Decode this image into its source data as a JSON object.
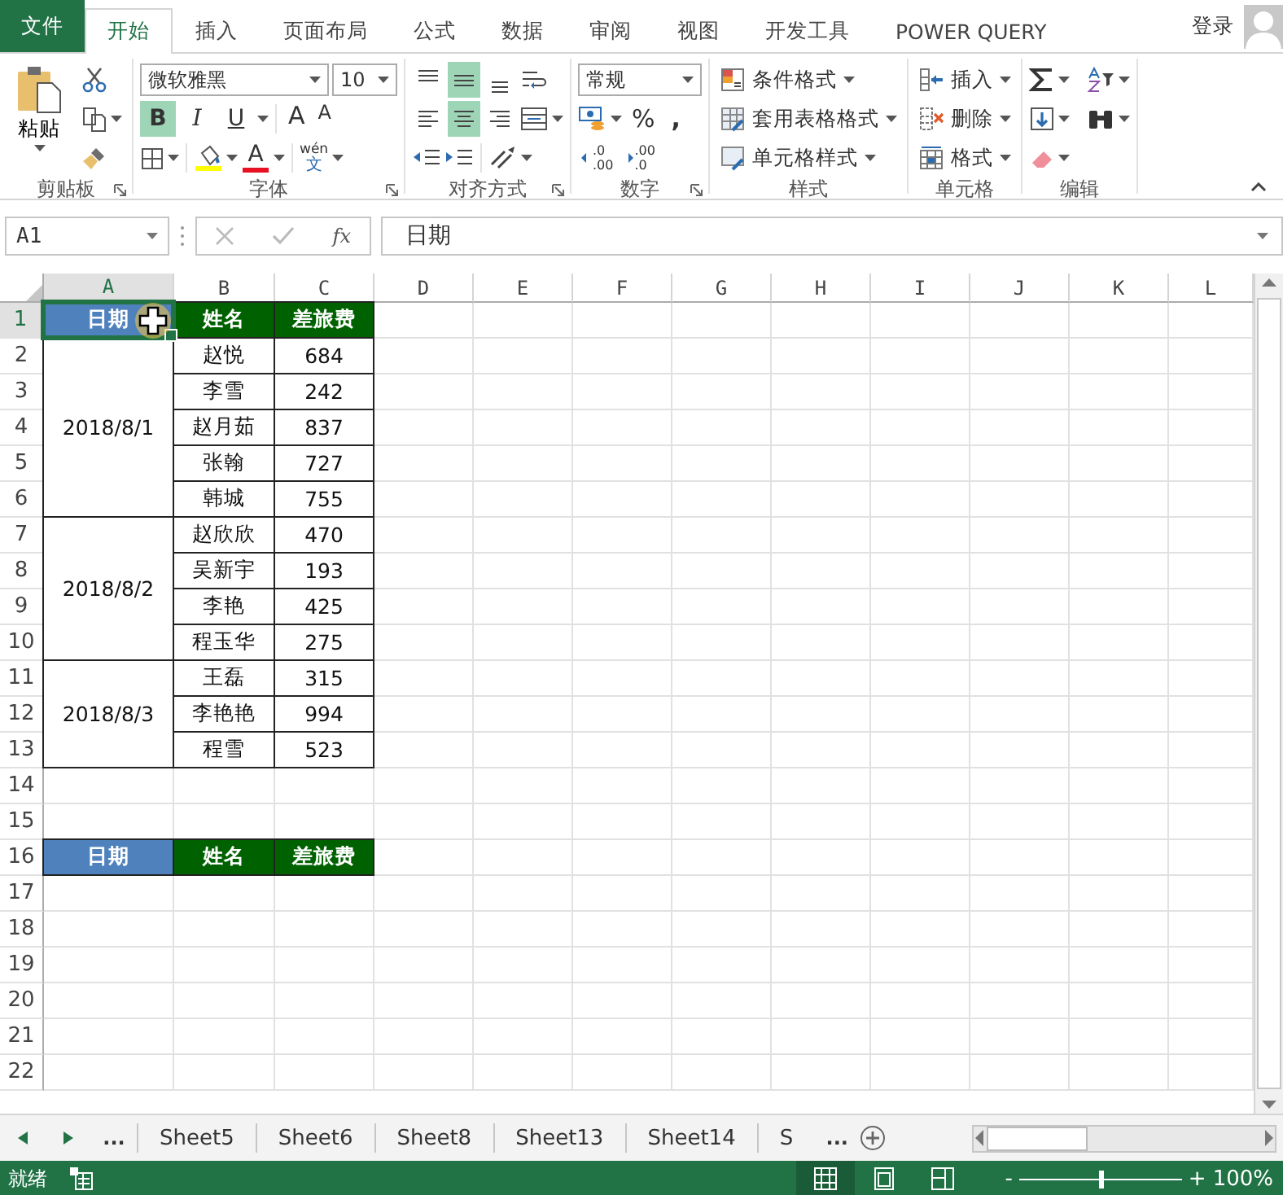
{
  "ribbon_tabs": [
    {
      "label": "文件",
      "kind": "file",
      "selected": false
    },
    {
      "label": "开始",
      "kind": "tab",
      "selected": true
    },
    {
      "label": "插入",
      "kind": "tab",
      "selected": false
    },
    {
      "label": "页面布局",
      "kind": "tab",
      "selected": false
    },
    {
      "label": "公式",
      "kind": "tab",
      "selected": false
    },
    {
      "label": "数据",
      "kind": "tab",
      "selected": false
    },
    {
      "label": "审阅",
      "kind": "tab",
      "selected": false
    },
    {
      "label": "视图",
      "kind": "tab",
      "selected": false
    },
    {
      "label": "开发工具",
      "kind": "tab",
      "selected": false
    },
    {
      "label": "POWER QUERY",
      "kind": "tab",
      "selected": false
    }
  ],
  "account": {
    "label": "登录"
  },
  "ribbon": {
    "groups": [
      {
        "kind": "clipboard",
        "label": "剪贴板",
        "launcher": true,
        "paste": "粘贴"
      },
      {
        "kind": "font",
        "label": "字体",
        "launcher": true,
        "font_name": "微软雅黑",
        "font_size": "10",
        "style_buttons": [
          {
            "kind": "bold",
            "text": "B",
            "selected": true
          },
          {
            "kind": "italic",
            "text": "I",
            "selected": false
          },
          {
            "kind": "underline",
            "text": "U",
            "selected": false
          }
        ],
        "size_buttons": [
          {
            "kind": "grow",
            "text": "A"
          },
          {
            "kind": "shrink",
            "text": "A"
          }
        ],
        "color_buttons": [
          {
            "kind": "fill",
            "color": "#ffff00"
          },
          {
            "kind": "font",
            "text": "A",
            "color": "#e81123"
          }
        ],
        "phonetic": {
          "top": "wén",
          "bottom": "文"
        }
      },
      {
        "kind": "alignment",
        "label": "对齐方式",
        "launcher": true,
        "buttons": [
          {
            "kind": "top",
            "selected": false
          },
          {
            "kind": "middle",
            "selected": true
          },
          {
            "kind": "bottom",
            "selected": false
          },
          {
            "kind": "left",
            "selected": false
          },
          {
            "kind": "center",
            "selected": true
          },
          {
            "kind": "right",
            "selected": false
          }
        ]
      },
      {
        "kind": "number",
        "label": "数字",
        "launcher": true,
        "format": "常规",
        "percent": "%",
        "comma": ",",
        "decimals": [
          {
            "kind": "increase",
            "top": ".0",
            "bottom": ".00"
          },
          {
            "kind": "decrease",
            "top": ".00",
            "bottom": ".0"
          }
        ]
      },
      {
        "kind": "styles",
        "label": "样式",
        "launcher": false,
        "items": [
          {
            "kind": "conditional",
            "text": "条件格式"
          },
          {
            "kind": "table",
            "text": "套用表格格式"
          },
          {
            "kind": "cell",
            "text": "单元格样式"
          }
        ]
      },
      {
        "kind": "cells",
        "label": "单元格",
        "launcher": false,
        "items": [
          {
            "kind": "insert",
            "text": "插入"
          },
          {
            "kind": "delete",
            "text": "删除"
          },
          {
            "kind": "format",
            "text": "格式"
          }
        ]
      },
      {
        "kind": "editing",
        "label": "编辑",
        "launcher": false
      }
    ]
  },
  "formula_bar": {
    "name_box": "A1",
    "fx": "fx",
    "value": "日期"
  },
  "sheet": {
    "columns": [
      {
        "label": "A",
        "selected": true
      },
      {
        "label": "B",
        "selected": false
      },
      {
        "label": "C",
        "selected": false
      },
      {
        "label": "D",
        "selected": false
      },
      {
        "label": "E",
        "selected": false
      },
      {
        "label": "F",
        "selected": false
      },
      {
        "label": "G",
        "selected": false
      },
      {
        "label": "H",
        "selected": false
      },
      {
        "label": "I",
        "selected": false
      },
      {
        "label": "J",
        "selected": false
      },
      {
        "label": "K",
        "selected": false
      },
      {
        "label": "L",
        "selected": false
      }
    ],
    "rows": [
      {
        "label": "1",
        "selected": true,
        "cells": [
          {
            "kind": "header",
            "text": "日期",
            "color": "#4f81bd",
            "selected": true
          },
          {
            "kind": "header",
            "text": "姓名",
            "color": "#006100",
            "selected": false
          },
          {
            "kind": "header",
            "text": "差旅费",
            "color": "#006100",
            "selected": false
          }
        ]
      },
      {
        "label": "2",
        "selected": false,
        "cells": [
          {
            "kind": "date",
            "text": "2018/8/1",
            "selected": false
          },
          {
            "kind": "text",
            "text": "赵悦",
            "selected": false
          },
          {
            "kind": "text",
            "text": "684",
            "selected": false
          }
        ]
      },
      {
        "label": "3",
        "selected": false,
        "cells": [
          {
            "kind": "merged"
          },
          {
            "kind": "text",
            "text": "李雪",
            "selected": false
          },
          {
            "kind": "text",
            "text": "242",
            "selected": false
          }
        ]
      },
      {
        "label": "4",
        "selected": false,
        "cells": [
          {
            "kind": "merged"
          },
          {
            "kind": "text",
            "text": "赵月茹",
            "selected": false
          },
          {
            "kind": "text",
            "text": "837",
            "selected": false
          }
        ]
      },
      {
        "label": "5",
        "selected": false,
        "cells": [
          {
            "kind": "merged"
          },
          {
            "kind": "text",
            "text": "张翰",
            "selected": false
          },
          {
            "kind": "text",
            "text": "727",
            "selected": false
          }
        ]
      },
      {
        "label": "6",
        "selected": false,
        "cells": [
          {
            "kind": "merged"
          },
          {
            "kind": "text",
            "text": "韩城",
            "selected": false
          },
          {
            "kind": "text",
            "text": "755",
            "selected": false
          }
        ]
      },
      {
        "label": "7",
        "selected": false,
        "cells": [
          {
            "kind": "date",
            "text": "2018/8/2",
            "selected": false
          },
          {
            "kind": "text",
            "text": "赵欣欣",
            "selected": false
          },
          {
            "kind": "text",
            "text": "470",
            "selected": false
          }
        ]
      },
      {
        "label": "8",
        "selected": false,
        "cells": [
          {
            "kind": "merged"
          },
          {
            "kind": "text",
            "text": "吴新宇",
            "selected": false
          },
          {
            "kind": "text",
            "text": "193",
            "selected": false
          }
        ]
      },
      {
        "label": "9",
        "selected": false,
        "cells": [
          {
            "kind": "merged"
          },
          {
            "kind": "text",
            "text": "李艳",
            "selected": false
          },
          {
            "kind": "text",
            "text": "425",
            "selected": false
          }
        ]
      },
      {
        "label": "10",
        "selected": false,
        "cells": [
          {
            "kind": "merged"
          },
          {
            "kind": "text",
            "text": "程玉华",
            "selected": false
          },
          {
            "kind": "text",
            "text": "275",
            "selected": false
          }
        ]
      },
      {
        "label": "11",
        "selected": false,
        "cells": [
          {
            "kind": "date",
            "text": "2018/8/3",
            "selected": false
          },
          {
            "kind": "text",
            "text": "王磊",
            "selected": false
          },
          {
            "kind": "text",
            "text": "315",
            "selected": false
          }
        ]
      },
      {
        "label": "12",
        "selected": false,
        "cells": [
          {
            "kind": "merged"
          },
          {
            "kind": "text",
            "text": "李艳艳",
            "selected": false
          },
          {
            "kind": "text",
            "text": "994",
            "selected": false
          }
        ]
      },
      {
        "label": "13",
        "selected": false,
        "cells": [
          {
            "kind": "merged"
          },
          {
            "kind": "text",
            "text": "程雪",
            "selected": false
          },
          {
            "kind": "text",
            "text": "523",
            "selected": false
          }
        ]
      },
      {
        "label": "14",
        "selected": false
      },
      {
        "label": "15",
        "selected": false
      },
      {
        "label": "16",
        "selected": false,
        "cells": [
          {
            "kind": "header",
            "text": "日期",
            "color": "#4f81bd",
            "selected": false
          },
          {
            "kind": "header",
            "text": "姓名",
            "color": "#006100",
            "selected": false
          },
          {
            "kind": "header",
            "text": "差旅费",
            "color": "#006100",
            "selected": false
          }
        ]
      },
      {
        "label": "17",
        "selected": false
      },
      {
        "label": "18",
        "selected": false
      },
      {
        "label": "19",
        "selected": false
      },
      {
        "label": "20",
        "selected": false
      },
      {
        "label": "21",
        "selected": false
      },
      {
        "label": "22",
        "selected": false
      }
    ]
  },
  "sheet_tabs": {
    "more_left": "...",
    "tabs": [
      {
        "label": "Sheet5",
        "selected": false
      },
      {
        "label": "Sheet6",
        "selected": false
      },
      {
        "label": "Sheet8",
        "selected": false
      },
      {
        "label": "Sheet13",
        "selected": false
      },
      {
        "label": "Sheet14",
        "selected": false
      },
      {
        "label": "S",
        "selected": false
      }
    ],
    "more_right": "..."
  },
  "status_bar": {
    "status": "就绪",
    "views": [
      {
        "kind": "normal",
        "selected": true
      },
      {
        "kind": "page_layout",
        "selected": false
      },
      {
        "kind": "page_break",
        "selected": false
      }
    ],
    "zoom": {
      "minus": "-",
      "plus": "+",
      "level": 0.5,
      "reading": "100%"
    }
  }
}
